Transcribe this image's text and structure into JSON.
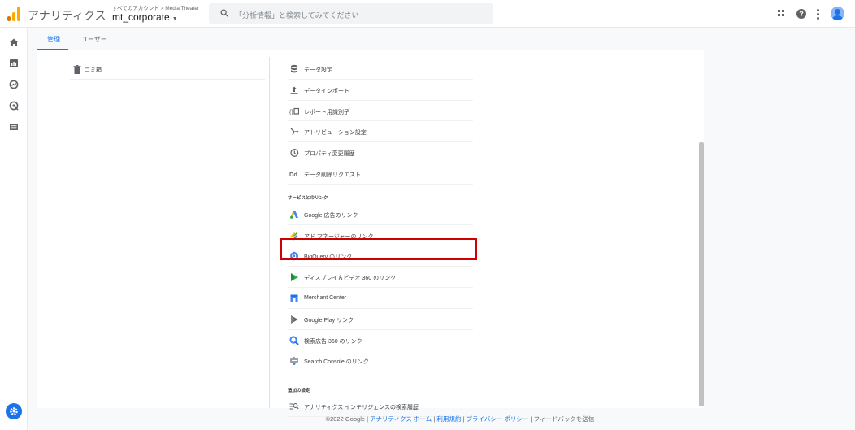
{
  "header": {
    "app_title": "アナリティクス",
    "breadcrumb": "すべてのアカウント > Media Theater",
    "account_name": "mt_corporate",
    "search_placeholder": "「分析情報」と検索してみてください"
  },
  "icons": {
    "logo": "analytics-logo-icon",
    "search": "search-icon",
    "apps": "apps-grid-icon",
    "help": "help-icon",
    "more": "more-vert-icon",
    "avatar": "avatar",
    "rail": [
      "home-icon",
      "reports-icon",
      "explore-icon",
      "advertising-icon",
      "configure-icon"
    ],
    "settings": "settings-gear-icon"
  },
  "tabs": [
    {
      "label": "管理",
      "active": true
    },
    {
      "label": "ユーザー",
      "active": false
    }
  ],
  "left_column": {
    "trash_label": "ゴミ箱"
  },
  "property_menu": [
    {
      "label": "データ設定",
      "icon": "database-icon"
    },
    {
      "label": "データインポート",
      "icon": "upload-icon"
    },
    {
      "label": "レポート用識別子",
      "icon": "report-identity-icon"
    },
    {
      "label": "アトリビューション設定",
      "icon": "attribution-icon"
    },
    {
      "label": "プロパティ変更履歴",
      "icon": "history-icon"
    },
    {
      "label": "データ削除リクエスト",
      "icon": "data-deletion-icon"
    }
  ],
  "links_section": {
    "title": "サービスとのリンク",
    "items": [
      {
        "label": "Google 広告のリンク",
        "icon": "google-ads-icon"
      },
      {
        "label": "アド マネージャーのリンク",
        "icon": "ad-manager-icon"
      },
      {
        "label": "BigQuery のリンク",
        "icon": "bigquery-icon",
        "highlighted": true
      },
      {
        "label": "ディスプレイ＆ビデオ 360 のリンク",
        "icon": "display-video-360-icon"
      },
      {
        "label": "Merchant Center",
        "icon": "merchant-center-icon"
      },
      {
        "label": "Google Play リンク",
        "icon": "google-play-icon"
      },
      {
        "label": "検索広告 360 のリンク",
        "icon": "search-ads-360-icon"
      },
      {
        "label": "Search Console のリンク",
        "icon": "search-console-icon"
      }
    ]
  },
  "additional_section": {
    "title": "追加の設定",
    "items": [
      {
        "label": "アナリティクス インテリジェンスの検索履歴",
        "icon": "intelligence-search-history-icon"
      }
    ]
  },
  "footer": {
    "copyright": "©2022 Google |",
    "home_link": "アナリティクス ホーム",
    "sep1": "|",
    "terms_link": "利用規約",
    "sep2": "|",
    "privacy_link": "プライバシー ポリシー",
    "sep3": "|",
    "feedback": "フィードバックを送信"
  },
  "colors": {
    "accent": "#1a73e8",
    "highlight_border": "#d00000"
  }
}
